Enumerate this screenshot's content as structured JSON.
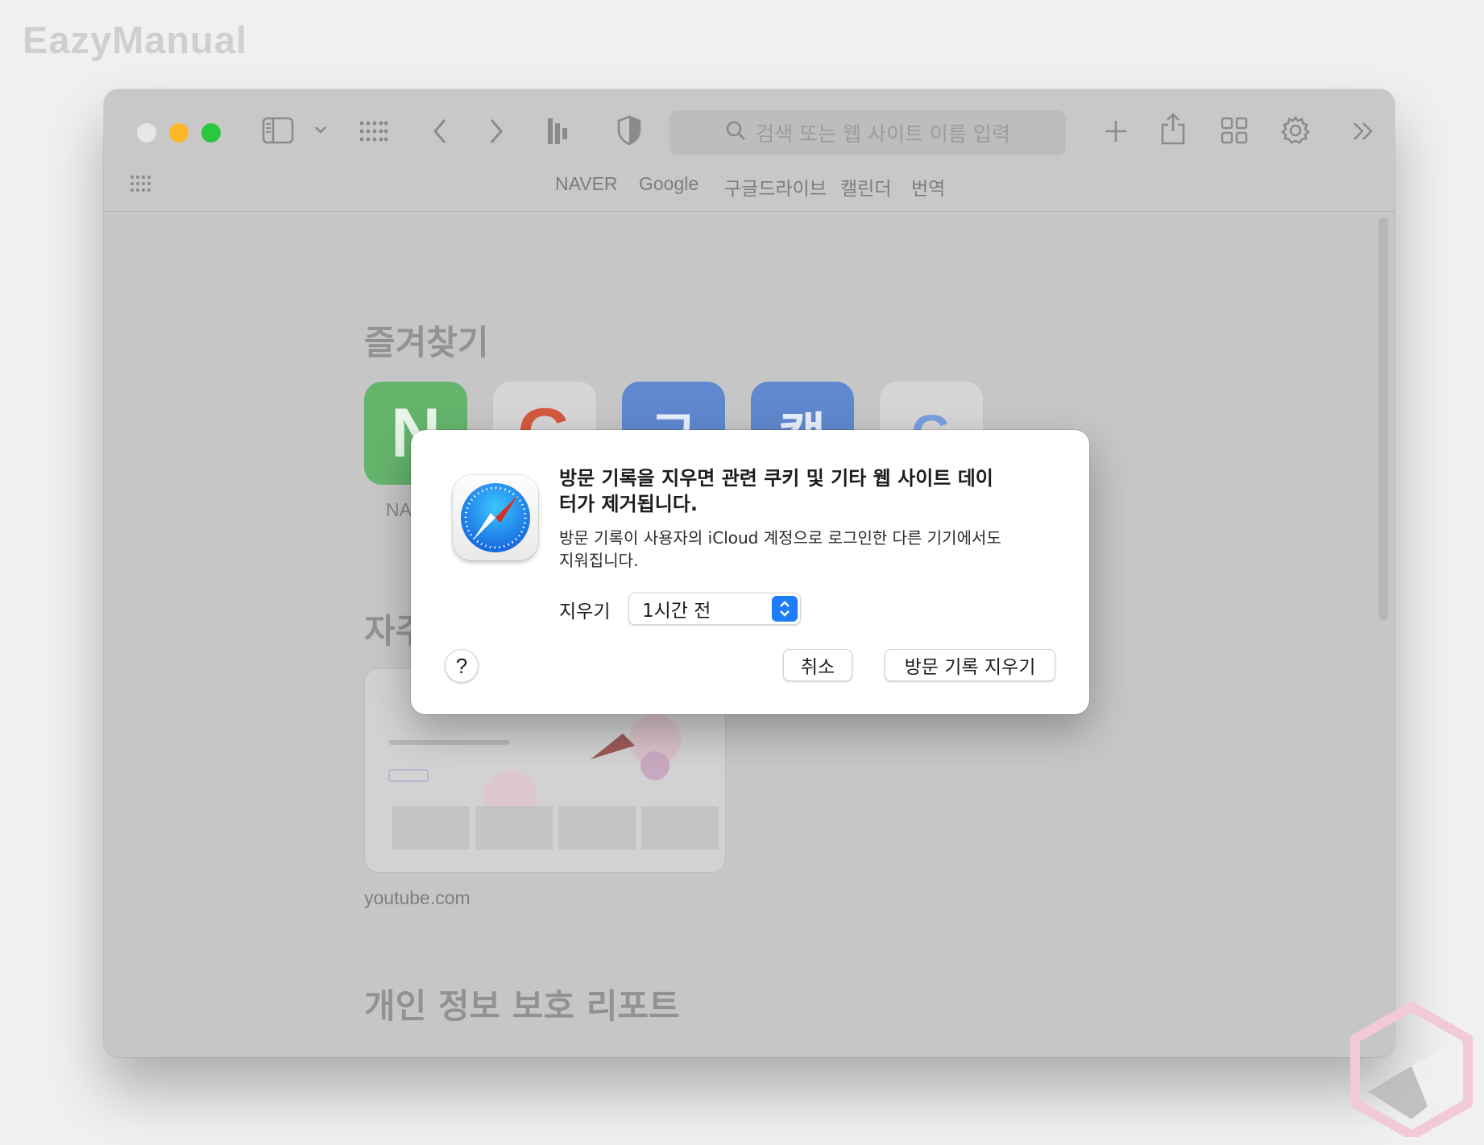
{
  "watermark": {
    "brand": "EazyManual"
  },
  "browser": {
    "address_bar": {
      "placeholder": "검색 또는 웹 사이트 이름 입력"
    },
    "favorites_bar": [
      "NAVER",
      "Google",
      "구글드라이브",
      "캘린더",
      "번역"
    ],
    "start_page": {
      "favorites_title": "즐겨찾기",
      "favorites": [
        {
          "letter": "N",
          "label": "NA",
          "color": "#4fbd5c"
        },
        {
          "letter": "G",
          "label": "",
          "color": "#d9d9d9"
        },
        {
          "letter": "구",
          "label": "",
          "color": "#5e87d6"
        },
        {
          "letter": "캘",
          "label": "",
          "color": "#5e87d6"
        },
        {
          "letter": "G",
          "label": "",
          "color": "#7a9fe4"
        }
      ],
      "frequent_title": "자주",
      "frequent_site": "youtube.com",
      "privacy_title": "개인 정보 보호 리포트"
    }
  },
  "dialog": {
    "title": "방문 기록을 지우면 관련 쿠키 및 기타 웹 사이트 데이터가 제거됩니다.",
    "message": "방문 기록이 사용자의 iCloud 계정으로 로그인한 다른 기기에서도 지워집니다.",
    "clear_label": "지우기",
    "clear_range_selected": "1시간 전",
    "help_label": "?",
    "cancel_label": "취소",
    "confirm_label": "방문 기록 지우기",
    "accent_color": "#1e7dfb"
  }
}
